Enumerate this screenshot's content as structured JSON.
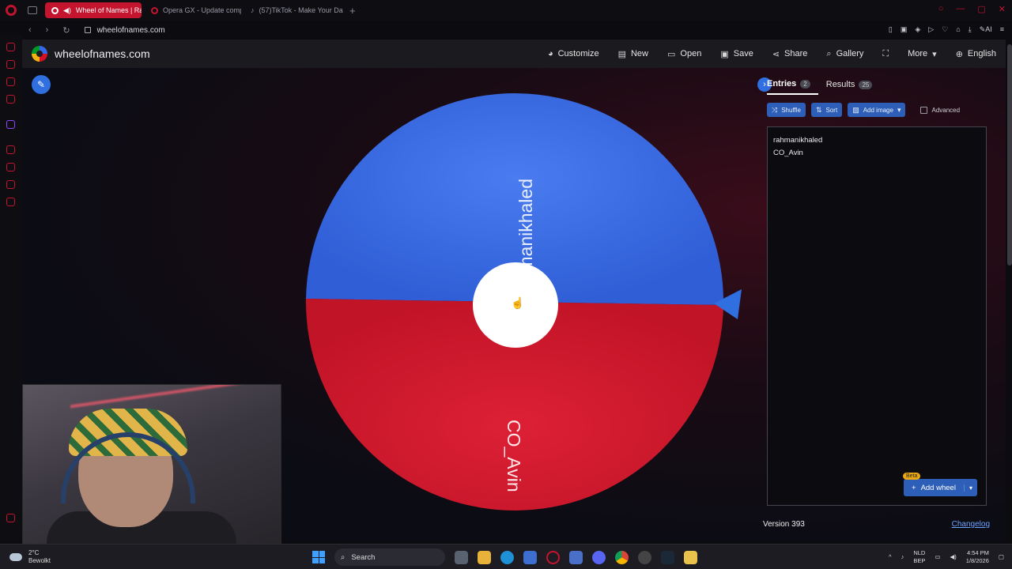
{
  "browser": {
    "tabs": [
      {
        "label": "Wheel of Names | Ran",
        "active": true
      },
      {
        "label": "Opera GX - Update comp",
        "active": false
      },
      {
        "label": "(57)TikTok - Make Your Da",
        "active": false
      }
    ],
    "new_tab": "+",
    "url": "wheelofnames.com"
  },
  "site": {
    "name": "wheelofnames.com",
    "menu": [
      {
        "label": "Customize",
        "icon": "palette-icon"
      },
      {
        "label": "New",
        "icon": "file-icon"
      },
      {
        "label": "Open",
        "icon": "folder-icon"
      },
      {
        "label": "Save",
        "icon": "save-icon"
      },
      {
        "label": "Share",
        "icon": "share-icon"
      },
      {
        "label": "Gallery",
        "icon": "search-icon"
      },
      {
        "label": "",
        "icon": "fullscreen-icon"
      },
      {
        "label": "More",
        "icon": "chevron-down-icon"
      },
      {
        "label": "English",
        "icon": "globe-icon"
      }
    ]
  },
  "wheel": {
    "segments": [
      {
        "label": "rahmanikhaled",
        "color": "#3d6fe3"
      },
      {
        "label": "CO_Avin",
        "color": "#d41a2e"
      }
    ]
  },
  "panel": {
    "tabs": [
      {
        "label": "Entries",
        "count": "2"
      },
      {
        "label": "Results",
        "count": "25"
      }
    ],
    "toolbar": {
      "shuffle": "Shuffle",
      "sort": "Sort",
      "add_image": "Add image",
      "advanced": "Advanced"
    },
    "entries": [
      "rahmanikhaled",
      "CO_Avin"
    ],
    "add_wheel": "Add wheel",
    "beta": "Beta",
    "version": "Version 393",
    "changelog": "Changelog"
  },
  "taskbar": {
    "weather_temp": "2°C",
    "weather_desc": "Bewolkt",
    "search": "Search",
    "lang1": "NLD",
    "lang2": "BEP",
    "time": "4:54 PM",
    "date": "1/8/2026"
  },
  "colors": {
    "accent": "#2f6fe0",
    "opera_red": "#c4142e"
  }
}
